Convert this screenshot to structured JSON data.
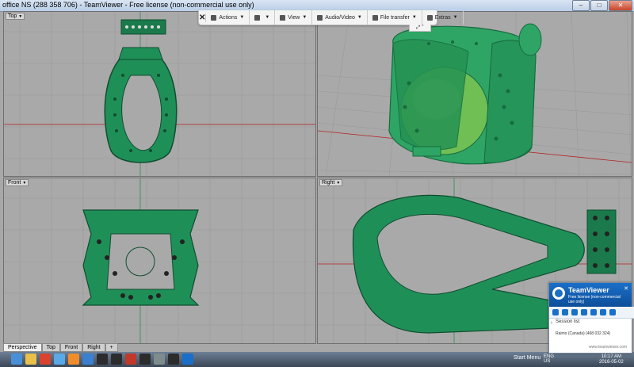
{
  "window": {
    "title": "office NS (288 358 706) - TeamViewer - Free license (non-commercial use only)"
  },
  "tv_toolbar": {
    "close_label": "✕",
    "items": [
      "Actions",
      "",
      "View",
      "Audio/Video",
      "File transfer",
      "Extras"
    ],
    "tab_label": "⤢ ⌃"
  },
  "viewports": {
    "top": "Top",
    "perspective": "",
    "front": "Front",
    "right": "Right"
  },
  "tabs": [
    "Perspective",
    "Top",
    "Front",
    "Right",
    "+"
  ],
  "taskbar": {
    "start_menu": "Start Menu",
    "tray": "ENG\nUS",
    "clock_time": "10:17 AM",
    "clock_date": "2016-05-02"
  },
  "tv_panel": {
    "brand": "TeamViewer",
    "license": "Free license (non-commercial use only)",
    "session_label": "Session list",
    "session_item": "Raimo (Canada) (468 032 324)",
    "footer": "www.teamviewer.com"
  },
  "colors": {
    "wire": "#1b7a4c",
    "model": "#2ea564",
    "grid_line": "#9a9a9a",
    "axis_red": "#b22222",
    "axis_green": "#2e8b57"
  }
}
